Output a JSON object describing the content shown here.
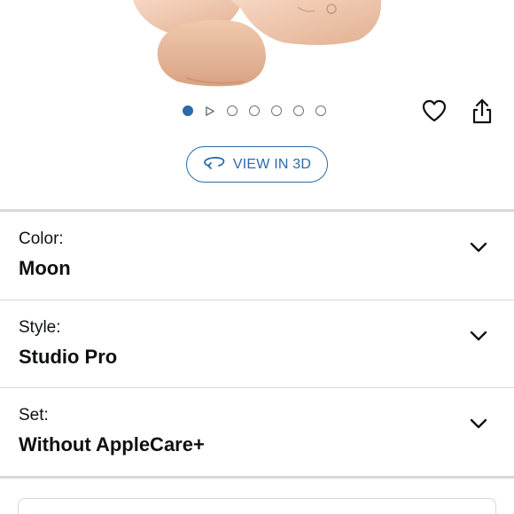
{
  "product": {
    "image_alt": "Moon-colored over-ear headphones"
  },
  "carousel": {
    "total_items": 7,
    "active_index": 0,
    "video_index": 1,
    "active_color": "#2c6aa8"
  },
  "actions": {
    "wishlist_icon": "heart-icon",
    "share_icon": "share-icon"
  },
  "view3d": {
    "label": "VIEW IN 3D",
    "icon": "rotate-3d-icon"
  },
  "variations": [
    {
      "label": "Color:",
      "value": "Moon"
    },
    {
      "label": "Style:",
      "value": "Studio Pro"
    },
    {
      "label": "Set:",
      "value": "Without AppleCare+"
    }
  ]
}
